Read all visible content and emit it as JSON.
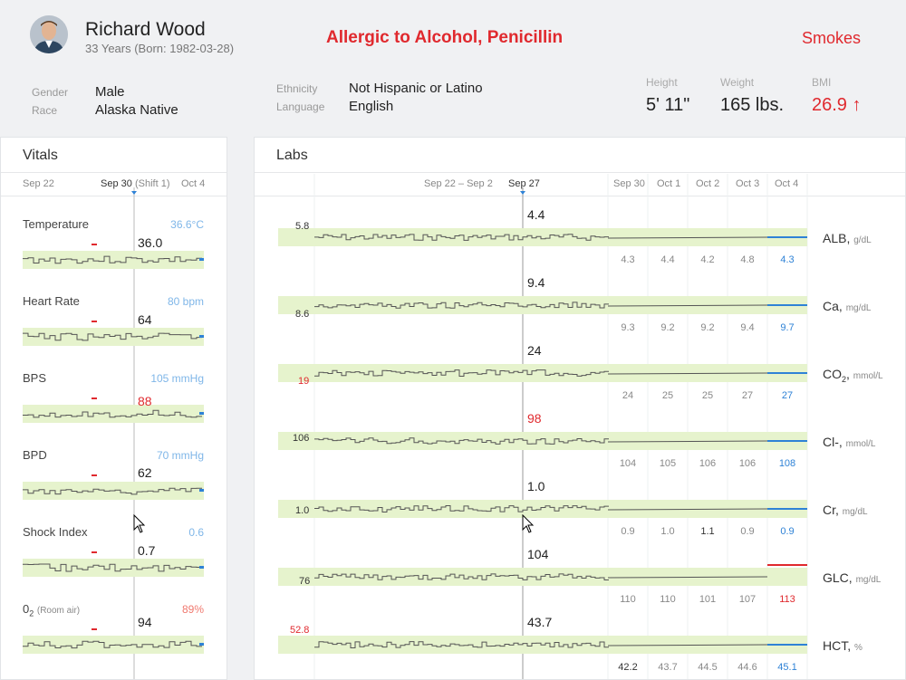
{
  "patient": {
    "name": "Richard Wood",
    "age_dob": "33 Years (Born: 1982-03-28)",
    "allergy": "Allergic to Alcohol, Penicillin",
    "smoking": "Smokes",
    "gender_label": "Gender",
    "gender": "Male",
    "race_label": "Race",
    "race": "Alaska Native",
    "ethnicity_label": "Ethnicity",
    "ethnicity": "Not Hispanic or Latino",
    "language_label": "Language",
    "language": "English",
    "height_label": "Height",
    "height": "5' 11\"",
    "weight_label": "Weight",
    "weight": "165 lbs.",
    "bmi_label": "BMI",
    "bmi": "26.9 ↑"
  },
  "colors": {
    "alert": "#e0292e",
    "latest_blue": "#2e82d6",
    "normal_band": "#e6f3cd",
    "sparkline": "#555555"
  },
  "vitals": {
    "title": "Vitals",
    "dates": [
      "Sep 22",
      "Sep 30",
      "(Shift 1)",
      "Oct 4"
    ],
    "items": [
      {
        "name": "Temperature",
        "latest": "36.6°C",
        "current": "36.0",
        "current_alert": false
      },
      {
        "name": "Heart Rate",
        "latest": "80 bpm",
        "current": "64",
        "current_alert": false
      },
      {
        "name": "BPS",
        "latest": "105 mmHg",
        "current": "88",
        "current_alert": true
      },
      {
        "name": "BPD",
        "latest": "70 mmHg",
        "current": "62",
        "current_alert": false
      },
      {
        "name": "Shock Index",
        "latest": "0.6",
        "current": "0.7",
        "current_alert": false
      },
      {
        "name_main": "0",
        "name_sub": "2",
        "name_note": "(Room air)",
        "latest": "89%",
        "latest_warn": true,
        "current": "94",
        "current_alert": false
      }
    ]
  },
  "labs": {
    "title": "Labs",
    "dates": [
      "Sep 22 – Sep 2",
      "Sep 27",
      "Sep 30",
      "Oct 1",
      "Oct 2",
      "Oct 3",
      "Oct 4"
    ],
    "items": [
      {
        "name": "ALB",
        "sub": "",
        "unit": "g/dL",
        "current": "4.4",
        "baseline": "5.8",
        "values": [
          "4.3",
          "4.4",
          "4.2",
          "4.8",
          "4.3"
        ]
      },
      {
        "name": "Ca",
        "sub": "",
        "unit": "mg/dL",
        "current": "9.4",
        "baseline": "8.6",
        "values": [
          "9.3",
          "9.2",
          "9.2",
          "9.4",
          "9.7"
        ]
      },
      {
        "name": "CO",
        "sub": "2",
        "unit": "mmol/L",
        "current": "24",
        "baseline": "19",
        "baseline_alert": true,
        "values": [
          "24",
          "25",
          "25",
          "27",
          "27"
        ]
      },
      {
        "name": "Cl-",
        "sub": "",
        "unit": "mmol/L",
        "current": "98",
        "current_alert": true,
        "baseline": "106",
        "values": [
          "104",
          "105",
          "106",
          "106",
          "108"
        ]
      },
      {
        "name": "Cr",
        "sub": "",
        "unit": "mg/dL",
        "current": "1.0",
        "baseline": "1.0",
        "values": [
          "0.9",
          "1.0",
          "1.1",
          "0.9",
          "0.9"
        ]
      },
      {
        "name": "GLC",
        "sub": "",
        "unit": "mg/dL",
        "current": "104",
        "baseline": "76",
        "values": [
          "110",
          "110",
          "101",
          "107",
          "113"
        ],
        "last_alert": true
      },
      {
        "name": "HCT",
        "sub": "",
        "unit": "%",
        "current": "43.7",
        "baseline": "52.8",
        "baseline_alert": true,
        "values": [
          "42.2",
          "43.7",
          "44.5",
          "44.6",
          "45.1"
        ]
      }
    ]
  }
}
